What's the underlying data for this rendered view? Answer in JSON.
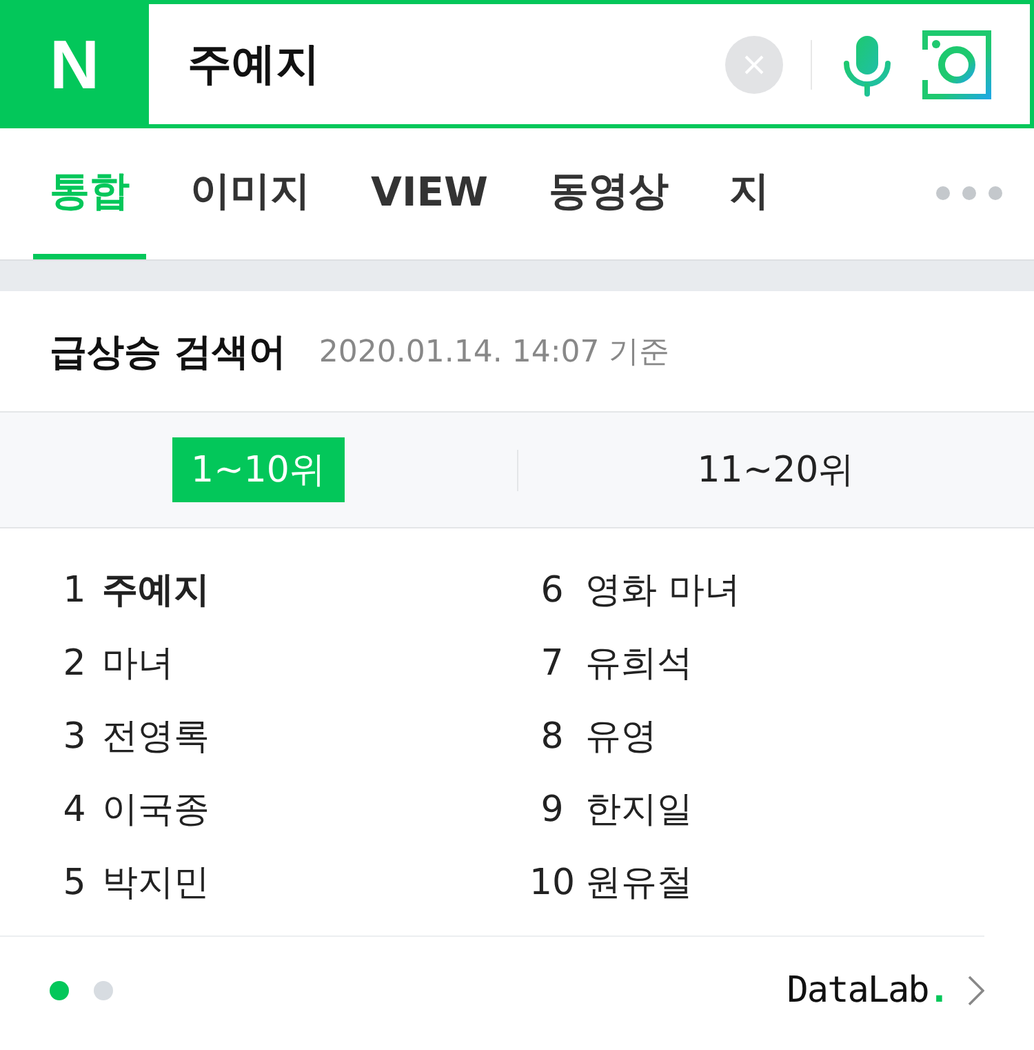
{
  "search": {
    "logo": "N",
    "query": "주예지"
  },
  "tabs": [
    {
      "label": "통합",
      "selected": true
    },
    {
      "label": "이미지",
      "selected": false
    },
    {
      "label": "VIEW",
      "selected": false
    },
    {
      "label": "동영상",
      "selected": false
    },
    {
      "label": "지",
      "selected": false
    }
  ],
  "trending": {
    "title": "급상승 검색어",
    "timestamp": "2020.01.14. 14:07 기준",
    "ranges": [
      {
        "label": "1~10위",
        "selected": true
      },
      {
        "label": "11~20위",
        "selected": false
      }
    ],
    "items": [
      {
        "rank": "1",
        "keyword": "주예지",
        "highlighted": true
      },
      {
        "rank": "2",
        "keyword": "마녀",
        "highlighted": false
      },
      {
        "rank": "3",
        "keyword": "전영록",
        "highlighted": false
      },
      {
        "rank": "4",
        "keyword": "이국종",
        "highlighted": false
      },
      {
        "rank": "5",
        "keyword": "박지민",
        "highlighted": false
      },
      {
        "rank": "6",
        "keyword": "영화 마녀",
        "highlighted": false
      },
      {
        "rank": "7",
        "keyword": "유희석",
        "highlighted": false
      },
      {
        "rank": "8",
        "keyword": "유영",
        "highlighted": false
      },
      {
        "rank": "9",
        "keyword": "한지일",
        "highlighted": false
      },
      {
        "rank": "10",
        "keyword": "원유철",
        "highlighted": false
      }
    ],
    "pages": [
      {
        "selected": true
      },
      {
        "selected": false
      }
    ],
    "brand": {
      "name": "DataLab",
      "mark": "."
    }
  }
}
